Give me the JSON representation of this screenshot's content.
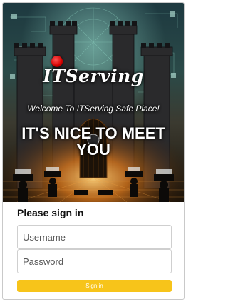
{
  "hero": {
    "logo_text": "ITServing",
    "welcome": "Welcome To ITServing Safe Place!",
    "headline": "IT'S NICE TO MEET YOU"
  },
  "signin": {
    "heading": "Please sign in",
    "username_placeholder": "Username",
    "password_placeholder": "Password",
    "button_label": "Sign in"
  },
  "colors": {
    "button": "#f7c41a",
    "logo_dot": "#d40000"
  }
}
